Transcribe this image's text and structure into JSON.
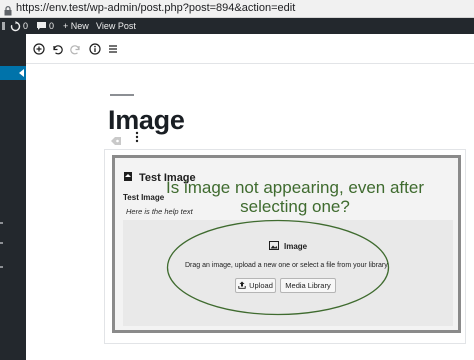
{
  "browser": {
    "url": "https://env.test/wp-admin/post.php?post=894&action=edit"
  },
  "admin_bar": {
    "updates_count": "0",
    "comments_count": "0",
    "new_label": "+ New",
    "view_post_label": "View Post"
  },
  "editor": {
    "page_title": "Image"
  },
  "block": {
    "title": "Test Image",
    "field_label": "Test Image",
    "help_text": "Here is the help text",
    "placeholder": {
      "title": "Image",
      "instructions": "Drag an image, upload a new one or select a file from your library.",
      "upload_label": "Upload",
      "media_library_label": "Media Library"
    }
  },
  "annotation": {
    "text": "Is image not appearing, even after selecting one?",
    "color": "#3f6b2f"
  },
  "colors": {
    "admin_bar": "#23282d",
    "admin_menu_active": "#0073aa"
  },
  "icons": [
    "lock-icon",
    "updates-icon",
    "comments-icon",
    "add-block-icon",
    "undo-icon",
    "redo-icon",
    "info-icon",
    "outline-icon",
    "block-type-icon",
    "more-options-icon",
    "image-icon",
    "upload-icon"
  ]
}
